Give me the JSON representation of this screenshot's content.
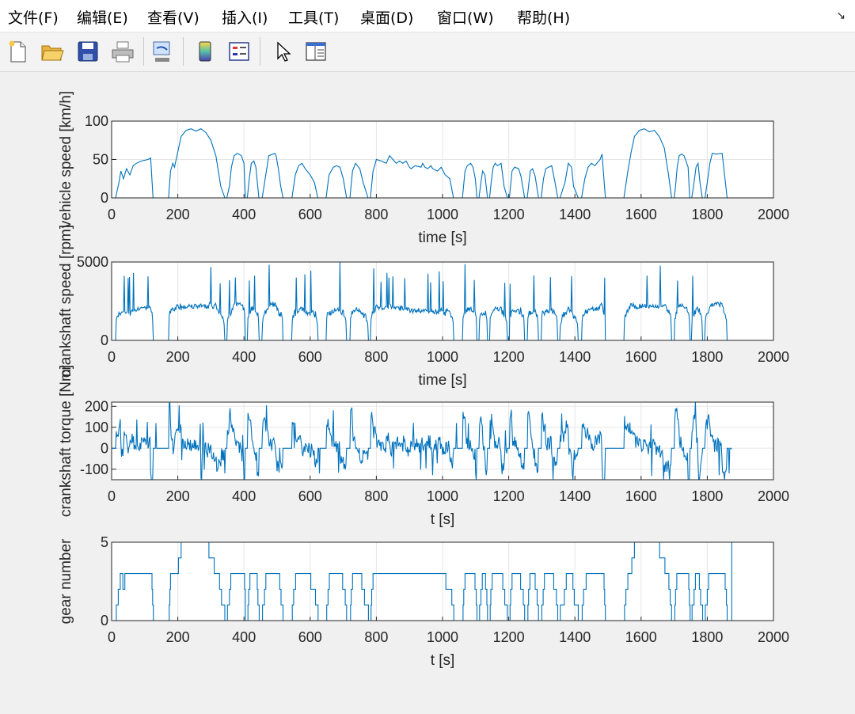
{
  "menu": {
    "items": [
      "文件(F)",
      "编辑(E)",
      "查看(V)",
      "插入(I)",
      "工具(T)",
      "桌面(D)",
      "窗口(W)",
      "帮助(H)"
    ],
    "dock_icon": "dock-arrow-icon"
  },
  "toolbar": {
    "buttons": [
      "new-figure-icon",
      "open-folder-icon",
      "save-icon",
      "print-icon",
      "link-plot-icon",
      "colorbar-icon",
      "legend-icon",
      "pointer-icon",
      "property-inspector-icon"
    ]
  },
  "chart_data": [
    {
      "type": "line",
      "xlabel": "time [s]",
      "ylabel": "vehicle speed [km/h]",
      "xlim": [
        0,
        2000
      ],
      "ylim": [
        0,
        100
      ],
      "xticks": [
        "0",
        "200",
        "400",
        "600",
        "800",
        "1000",
        "1200",
        "1400",
        "1600",
        "1800",
        "2000"
      ],
      "yticks": [
        "0",
        "50",
        "100"
      ],
      "grid": true,
      "color": "#0072BD",
      "x": [
        0,
        12,
        22,
        28,
        36,
        45,
        55,
        65,
        75,
        90,
        110,
        118,
        125,
        160,
        165,
        172,
        178,
        185,
        190,
        200,
        210,
        225,
        240,
        255,
        270,
        285,
        300,
        315,
        330,
        342,
        348,
        356,
        362,
        370,
        380,
        392,
        400,
        404,
        410,
        416,
        422,
        430,
        436,
        445,
        455,
        475,
        493,
        497,
        503,
        511,
        518,
        530,
        545,
        555,
        565,
        575,
        585,
        600,
        613,
        623,
        638,
        648,
        657,
        670,
        680,
        690,
        700,
        710,
        720,
        728,
        737,
        750,
        760,
        775,
        782,
        790,
        795,
        800,
        815,
        830,
        840,
        850,
        860,
        870,
        880,
        890,
        900,
        905,
        917,
        935,
        940,
        947,
        955,
        965,
        970,
        985,
        996,
        1008,
        1022,
        1033,
        1042,
        1052,
        1060,
        1068,
        1075,
        1085,
        1092,
        1099,
        1104,
        1110,
        1116,
        1121,
        1128,
        1136,
        1142,
        1147,
        1153,
        1159,
        1166,
        1177,
        1186,
        1196,
        1202,
        1210,
        1218,
        1230,
        1237,
        1248,
        1256,
        1265,
        1272,
        1280,
        1290,
        1298,
        1305,
        1312,
        1320,
        1330,
        1340,
        1348,
        1355,
        1370,
        1380,
        1390,
        1396,
        1410,
        1420,
        1430,
        1440,
        1450,
        1460,
        1470,
        1476,
        1482,
        1492,
        1520,
        1538,
        1548,
        1560,
        1570,
        1580,
        1595,
        1610,
        1625,
        1640,
        1655,
        1670,
        1683,
        1692,
        1700,
        1704,
        1709,
        1715,
        1722,
        1730,
        1742,
        1747,
        1753,
        1760,
        1766,
        1772,
        1778,
        1785,
        1793,
        1800,
        1808,
        1815,
        1827,
        1845,
        1860,
        1872,
        1875
      ],
      "y": [
        0,
        0,
        20,
        35,
        25,
        38,
        30,
        42,
        45,
        48,
        50,
        52,
        0,
        0,
        0,
        0,
        35,
        45,
        40,
        60,
        80,
        88,
        90,
        87,
        90,
        85,
        75,
        55,
        15,
        0,
        0,
        15,
        40,
        55,
        58,
        55,
        45,
        0,
        0,
        25,
        45,
        48,
        40,
        0,
        0,
        55,
        58,
        55,
        40,
        15,
        0,
        0,
        0,
        30,
        42,
        45,
        38,
        30,
        20,
        0,
        0,
        0,
        30,
        40,
        42,
        40,
        25,
        0,
        0,
        35,
        45,
        38,
        20,
        0,
        0,
        35,
        42,
        50,
        48,
        45,
        55,
        50,
        45,
        48,
        45,
        48,
        40,
        38,
        42,
        40,
        45,
        40,
        38,
        42,
        38,
        35,
        40,
        30,
        25,
        0,
        0,
        0,
        0,
        35,
        42,
        45,
        40,
        25,
        0,
        0,
        20,
        35,
        30,
        0,
        0,
        20,
        40,
        45,
        42,
        45,
        15,
        0,
        0,
        35,
        40,
        38,
        28,
        0,
        0,
        35,
        38,
        28,
        0,
        0,
        25,
        38,
        40,
        42,
        20,
        0,
        0,
        20,
        45,
        40,
        15,
        0,
        0,
        25,
        40,
        45,
        42,
        47,
        50,
        57,
        0,
        0,
        0,
        0,
        35,
        60,
        80,
        88,
        90,
        86,
        88,
        80,
        65,
        30,
        0,
        0,
        15,
        40,
        55,
        57,
        55,
        40,
        0,
        0,
        20,
        40,
        45,
        20,
        0,
        0,
        20,
        45,
        58,
        57,
        58,
        0,
        0
      ]
    },
    {
      "type": "line",
      "xlabel": "time [s]",
      "ylabel": "crankshaft speed [rpm]",
      "xlim": [
        0,
        2000
      ],
      "ylim": [
        0,
        5000
      ],
      "xticks": [
        "0",
        "200",
        "400",
        "600",
        "800",
        "1000",
        "1200",
        "1400",
        "1600",
        "1800",
        "2000"
      ],
      "yticks": [
        "0",
        "5000"
      ],
      "grid": true,
      "color": "#0072BD"
    },
    {
      "type": "line",
      "xlabel": "t [s]",
      "ylabel": "crankshaft torque [Nm]",
      "xlim": [
        0,
        2000
      ],
      "ylim": [
        -150,
        220
      ],
      "xticks": [
        "0",
        "200",
        "400",
        "600",
        "800",
        "1000",
        "1200",
        "1400",
        "1600",
        "1800",
        "2000"
      ],
      "yticks": [
        "-100",
        "0",
        "100",
        "200"
      ],
      "grid": true,
      "color": "#0072BD"
    },
    {
      "type": "line",
      "xlabel": "t [s]",
      "ylabel": "gear number",
      "xlim": [
        0,
        2000
      ],
      "ylim": [
        0,
        5
      ],
      "xticks": [
        "0",
        "200",
        "400",
        "600",
        "800",
        "1000",
        "1200",
        "1400",
        "1600",
        "1800",
        "2000"
      ],
      "yticks": [
        "0",
        "5"
      ],
      "grid": true,
      "color": "#0072BD"
    }
  ]
}
